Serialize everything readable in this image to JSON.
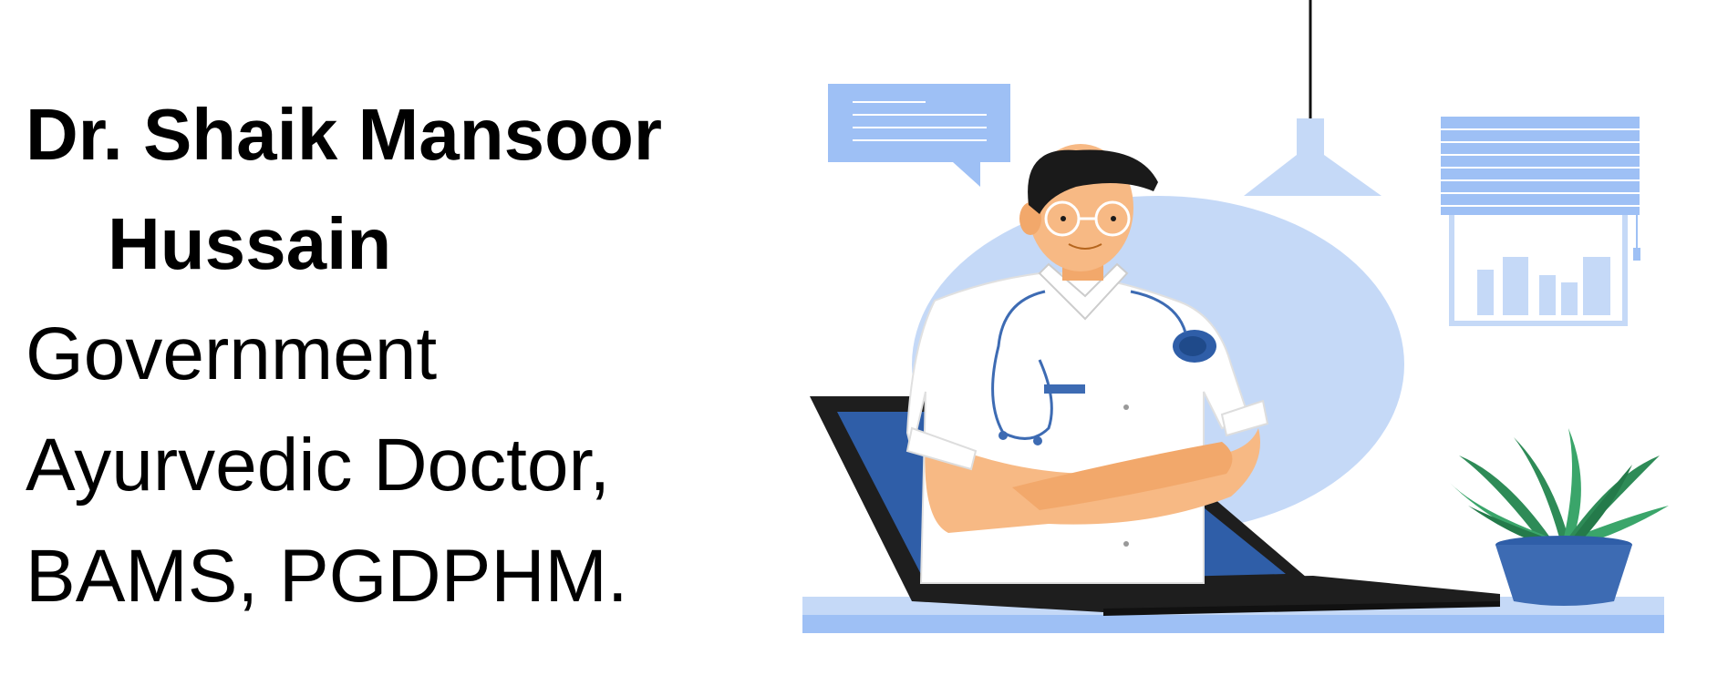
{
  "profile": {
    "name_line_1": "Dr. Shaik Mansoor",
    "name_line_2": "Hussain",
    "title_line_1": "Government",
    "title_line_2": "Ayurvedic Doctor,",
    "title_line_3": "BAMS, PGDPHM."
  },
  "illustration": {
    "subject": "doctor-emerging-from-laptop",
    "colors": {
      "light_blue": "#c5d9f7",
      "mid_blue": "#9ec0f5",
      "dark_blue": "#2f5ea8",
      "laptop_black": "#1e1e1e",
      "skin": "#f7b984",
      "coat": "#ffffff",
      "hair": "#1a1a1a",
      "plant_green": "#2e8b57",
      "pot_blue": "#3d6bb3"
    }
  }
}
